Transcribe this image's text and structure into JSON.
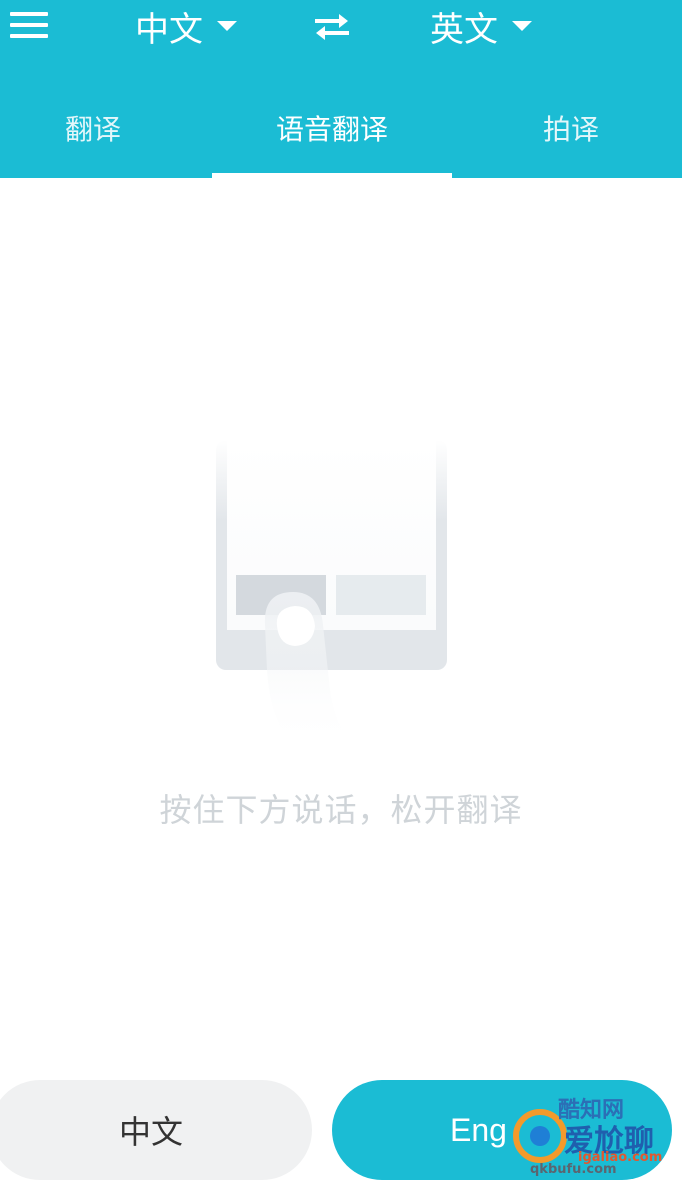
{
  "header": {
    "source_language": "中文",
    "target_language": "英文",
    "icons": {
      "menu": "menu-icon",
      "swap": "swap-arrows-icon",
      "dropdown": "caret-down-icon"
    }
  },
  "tabs": [
    {
      "label": "翻译",
      "active": false
    },
    {
      "label": "语音翻译",
      "active": true
    },
    {
      "label": "拍译",
      "active": false
    }
  ],
  "main": {
    "illustration": "press-and-hold-phone-illustration",
    "hint": "按住下方说话，松开翻译"
  },
  "bottom": {
    "left_button_label": "中文",
    "right_button_label": "Eng"
  },
  "watermark": {
    "text_top": "酷知网",
    "text_main": "爱尬聊",
    "text_sub": "igaliao.com",
    "text_bottom": "qkbufu.com"
  },
  "colors": {
    "accent": "#1bbcd4",
    "header_text": "#ffffff",
    "hint_text": "#cfd4d8",
    "left_button_bg": "#f0f1f2"
  }
}
